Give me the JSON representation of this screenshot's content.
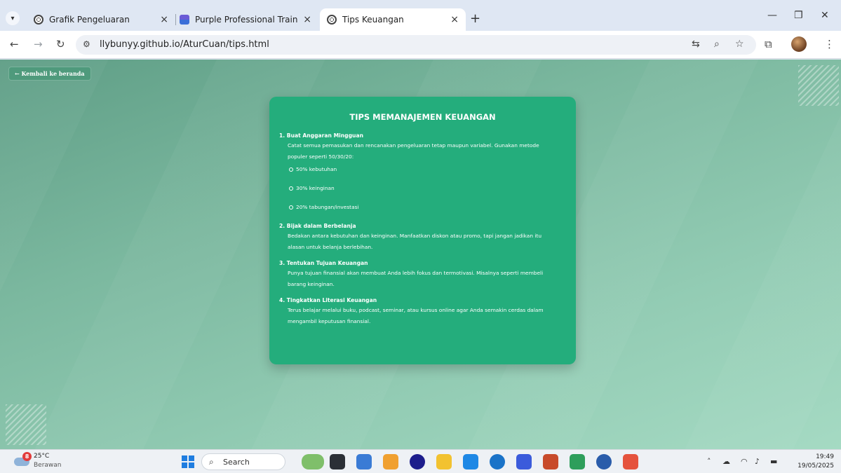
{
  "browser": {
    "tabs": [
      {
        "title": "Grafik Pengeluaran",
        "active": false
      },
      {
        "title": "Purple Professional Training Ma",
        "active": false
      },
      {
        "title": "Tips Keuangan",
        "active": true
      }
    ],
    "new_tab_label": "+",
    "close_glyph": "×",
    "url": "llybunyy.github.io/AturCuan/tips.html"
  },
  "page": {
    "back_label": "← Kembali ke beranda",
    "card_title": "TIPS MEMANAJEMEN KEUANGAN",
    "tips": [
      {
        "heading": "1. Buat Anggaran Mingguan",
        "text": "Catat semua pemasukan dan rencanakan pengeluaran tetap maupun variabel. Gunakan metode populer seperti 50/30/20:",
        "bullets": [
          "50% kebutuhan",
          "30% keinginan",
          "20% tabungan/investasi"
        ]
      },
      {
        "heading": "2. Bijak dalam Berbelanja",
        "text": "Bedakan antara kebutuhan dan keinginan. Manfaatkan diskon atau promo, tapi jangan jadikan itu alasan untuk belanja berlebihan."
      },
      {
        "heading": "3. Tentukan Tujuan Keuangan",
        "text": "Punya tujuan finansial akan membuat Anda lebih fokus dan termotivasi. Misalnya seperti membeli barang keinginan."
      },
      {
        "heading": "4. Tingkatkan Literasi Keuangan",
        "text": "Terus belajar melalui buku, podcast, seminar, atau kursus online agar Anda semakin cerdas dalam mengambil keputusan finansial."
      }
    ]
  },
  "taskbar": {
    "weather_badge": "8",
    "temperature": "25°C",
    "condition": "Berawan",
    "search_label": "Search",
    "time": "19:49",
    "date": "19/05/2025",
    "app_colors": [
      "#7fbf6a",
      "#2b2f36",
      "#3a7bd5",
      "#f0a030",
      "#1d1d8c",
      "#f2c230",
      "#1e88e5",
      "#1a73c8",
      "#3b5bdb",
      "#c84b2b",
      "#2e9e5b",
      "#2a5caa",
      "#e5533d"
    ]
  },
  "colors": {
    "card_bg": "#24ad7c",
    "page_gradient_start": "#5f9e86",
    "page_gradient_end": "#a5dac3"
  }
}
